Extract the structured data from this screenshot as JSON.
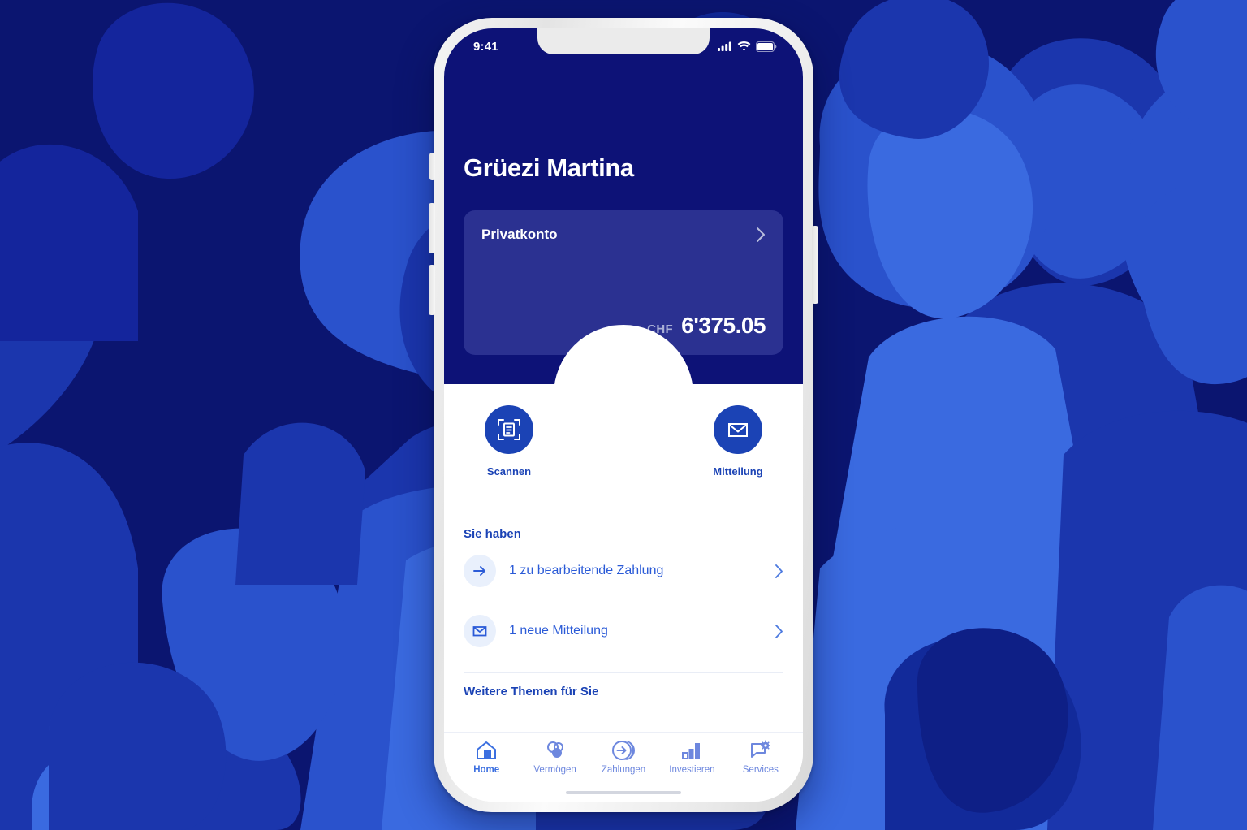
{
  "theme": {
    "header_navy": "#0d1277",
    "card_navy": "#2b3191",
    "accent_blue": "#1b43b5",
    "link_blue": "#2b5bd7",
    "tab_blue": "#6d87de",
    "icon_bg": "#e9f0fc",
    "bg_dark": "#0b1570",
    "bg_mid": "#14259c",
    "bg_light": "#3a6ae0"
  },
  "status_bar": {
    "time": "9:41",
    "signal_icon": "cellular-signal-icon",
    "wifi_icon": "wifi-icon",
    "battery_icon": "battery-icon"
  },
  "header": {
    "greeting": "Grüezi Martina"
  },
  "account_card": {
    "name": "Privatkonto",
    "chevron_icon": "chevron-right-icon",
    "currency": "CHF",
    "balance": "6'375.05"
  },
  "quick_actions": [
    {
      "label": "Scannen",
      "icon": "document-scan-icon",
      "style": "circle"
    },
    {
      "label": "",
      "icon": "video-camera-icon",
      "style": "plain"
    },
    {
      "label": "Mitteilung",
      "icon": "envelope-icon",
      "style": "circle"
    }
  ],
  "sections": {
    "you_have_title": "Sie haben",
    "items": [
      {
        "label": "1 zu bearbeitende Zahlung",
        "icon": "arrow-right-icon",
        "chevron_icon": "chevron-right-icon"
      },
      {
        "label": "1 neue Mitteilung",
        "icon": "envelope-icon",
        "chevron_icon": "chevron-right-icon"
      }
    ],
    "more_topics_title": "Weitere Themen für Sie"
  },
  "tab_bar": [
    {
      "label": "Home",
      "icon": "house-icon",
      "active": true
    },
    {
      "label": "Vermögen",
      "icon": "circles-icon",
      "active": false
    },
    {
      "label": "Zahlungen",
      "icon": "arrow-circle-icon",
      "active": false
    },
    {
      "label": "Investieren",
      "icon": "bar-chart-icon",
      "active": false
    },
    {
      "label": "Services",
      "icon": "chat-gear-icon",
      "active": false
    }
  ]
}
